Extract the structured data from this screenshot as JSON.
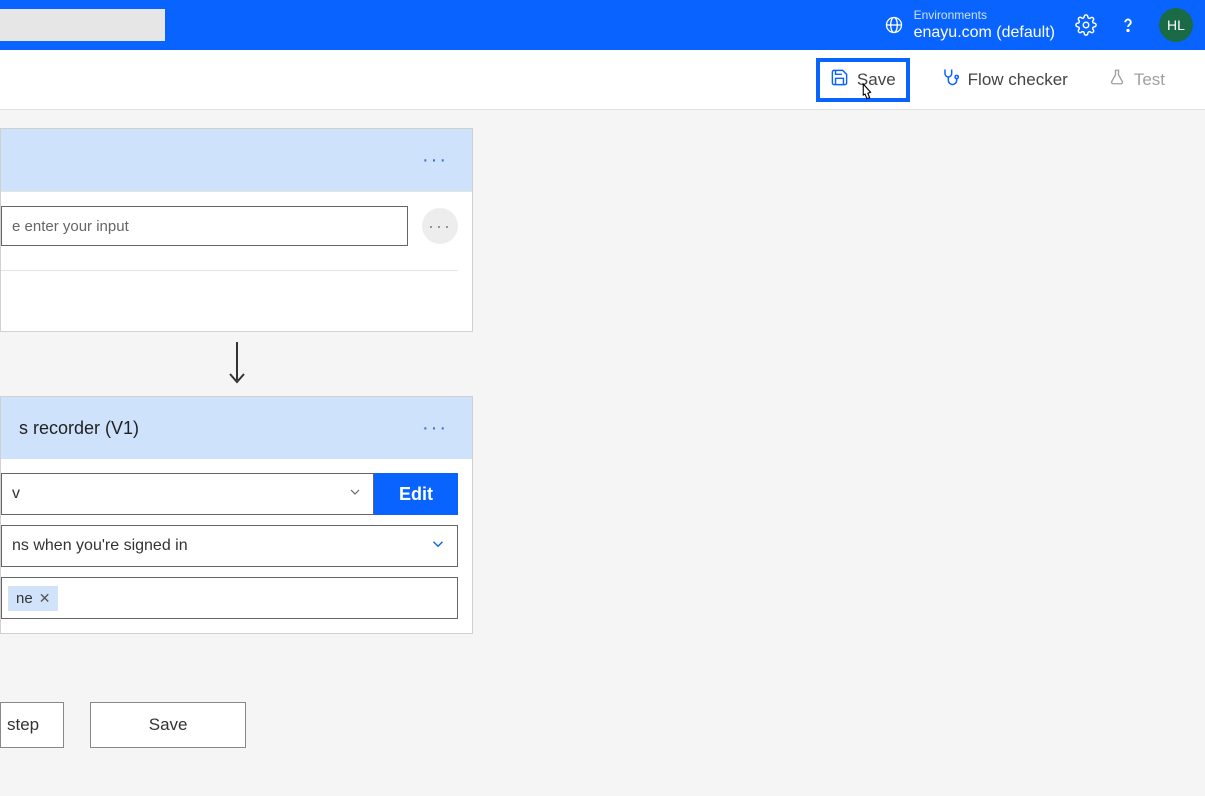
{
  "header": {
    "search_placeholder": "",
    "env_label": "Environments",
    "env_name": "enayu.com (default)",
    "avatar_initials": "HL"
  },
  "toolbar": {
    "save_label": "Save",
    "flow_checker_label": "Flow checker",
    "test_label": "Test"
  },
  "card1": {
    "input_placeholder": "e enter your input"
  },
  "card2": {
    "title": "s recorder (V1)",
    "dropdown1_value": "v",
    "edit_label": "Edit",
    "dropdown2_value": "ns when you're signed in",
    "token_text": "ne"
  },
  "footer": {
    "step_label": "step",
    "save_label": "Save"
  }
}
